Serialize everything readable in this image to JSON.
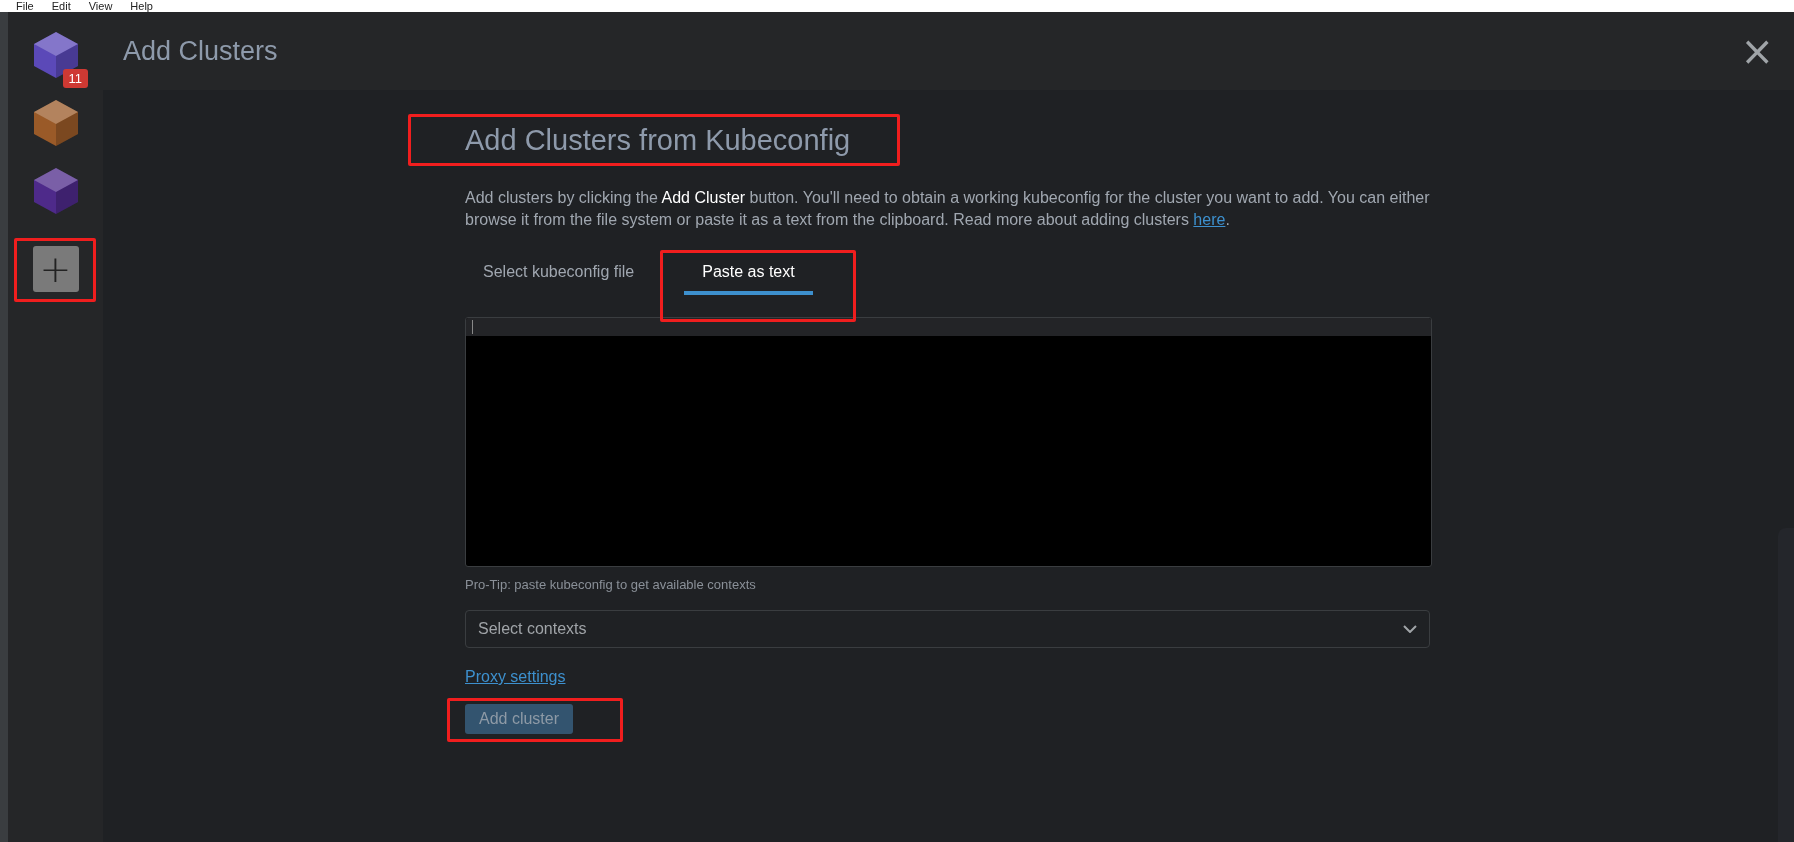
{
  "menu": [
    {
      "label": "File"
    },
    {
      "label": "Edit"
    },
    {
      "label": "View"
    },
    {
      "label": "Help"
    }
  ],
  "sidebar": {
    "clusters": [
      {
        "color": "#5b49b8",
        "badge": "11"
      },
      {
        "color": "#9a5a28"
      },
      {
        "color": "#4e2a8a"
      }
    ],
    "add_button": {
      "label": "+"
    }
  },
  "header": {
    "title": "Add Clusters",
    "close": "×"
  },
  "content": {
    "heading": "Add Clusters from Kubeconfig",
    "description": "Add clusters by clicking the **Add Cluster** button. You'll need to obtain a working kubeconfig for the cluster you want to add. You can either browse it from the file system or paste it as a text from the clipboard. Read more about adding clusters",
    "description_link": "here",
    "description_end": ".",
    "tabs": [
      {
        "label": "Select kubeconfig file",
        "selected": false
      },
      {
        "label": "Paste as text",
        "selected": true
      }
    ],
    "tip": "Pro-Tip: paste kubeconfig to get available contexts",
    "contexts_select": {
      "placeholder": "Select contexts"
    },
    "proxy_link": "Proxy settings",
    "submit": {
      "label": "Add cluster",
      "disabled": true
    }
  }
}
